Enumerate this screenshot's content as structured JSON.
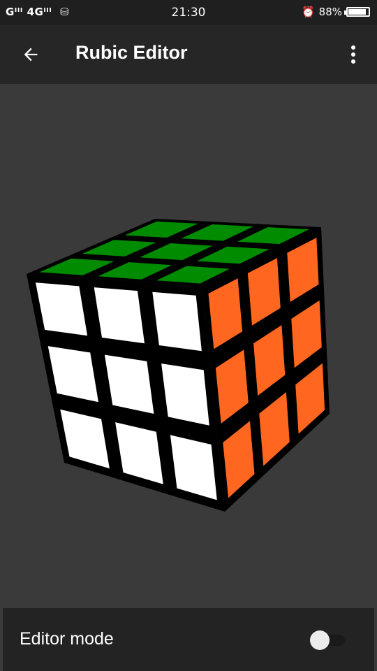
{
  "status_bar": {
    "signal_text": "Gᴵᴵᴵ 4Gᴵᴵᴵ",
    "clock": "21:30",
    "battery_percent": "88%",
    "battery_level": 0.88
  },
  "toolbar": {
    "title": "Rubic Editor",
    "back_icon": "arrow-left-icon",
    "menu_icon": "more-vert-icon"
  },
  "cube": {
    "colors": {
      "top": "#008b00",
      "front": "#ffffff",
      "right": "#ff6620",
      "edge": "#000000"
    }
  },
  "bottom_bar": {
    "label": "Editor mode",
    "switch_on": false
  }
}
